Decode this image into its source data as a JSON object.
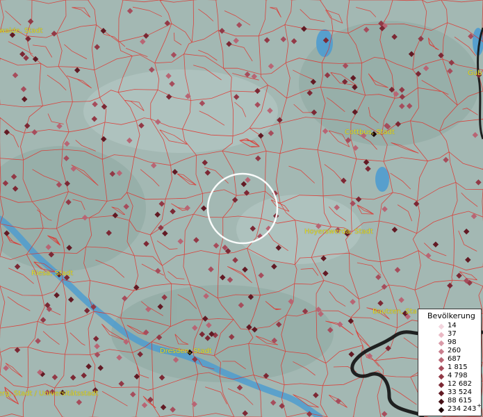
{
  "map": {
    "cities": [
      {
        "name": "walde, Stadt"
      },
      {
        "name": "Cottbus, Stadt"
      },
      {
        "name": "Gub"
      },
      {
        "name": "Hoyerswerda, Stadt"
      },
      {
        "name": "Riesa, Stadt"
      },
      {
        "name": "Bautzen, Sta"
      },
      {
        "name": "Dresden, Stadt"
      },
      {
        "name": "erg, Stadt / Universitätsstadt"
      }
    ]
  },
  "legend": {
    "title": "Bevölkerung",
    "items": [
      {
        "label": "14",
        "color": "#f3d5de"
      },
      {
        "label": "37",
        "color": "#e9b8c4"
      },
      {
        "label": "98",
        "color": "#d99aa8"
      },
      {
        "label": "260",
        "color": "#c97f8e"
      },
      {
        "label": "687",
        "color": "#b86574"
      },
      {
        "label": "1 815",
        "color": "#a64d5c"
      },
      {
        "label": "4 798",
        "color": "#923946"
      },
      {
        "label": "12 682",
        "color": "#7c2834"
      },
      {
        "label": "33 524",
        "color": "#621a24"
      },
      {
        "label": "88 615",
        "color": "#451016"
      },
      {
        "label": "234 243",
        "color": "#1e0508"
      }
    ],
    "overflow_mark": "+"
  },
  "colors": {
    "background": "#9fb5b0",
    "borders": "#e0302a",
    "water": "#5aa6d6",
    "state_border": "#111111",
    "label": "#e8e020"
  }
}
